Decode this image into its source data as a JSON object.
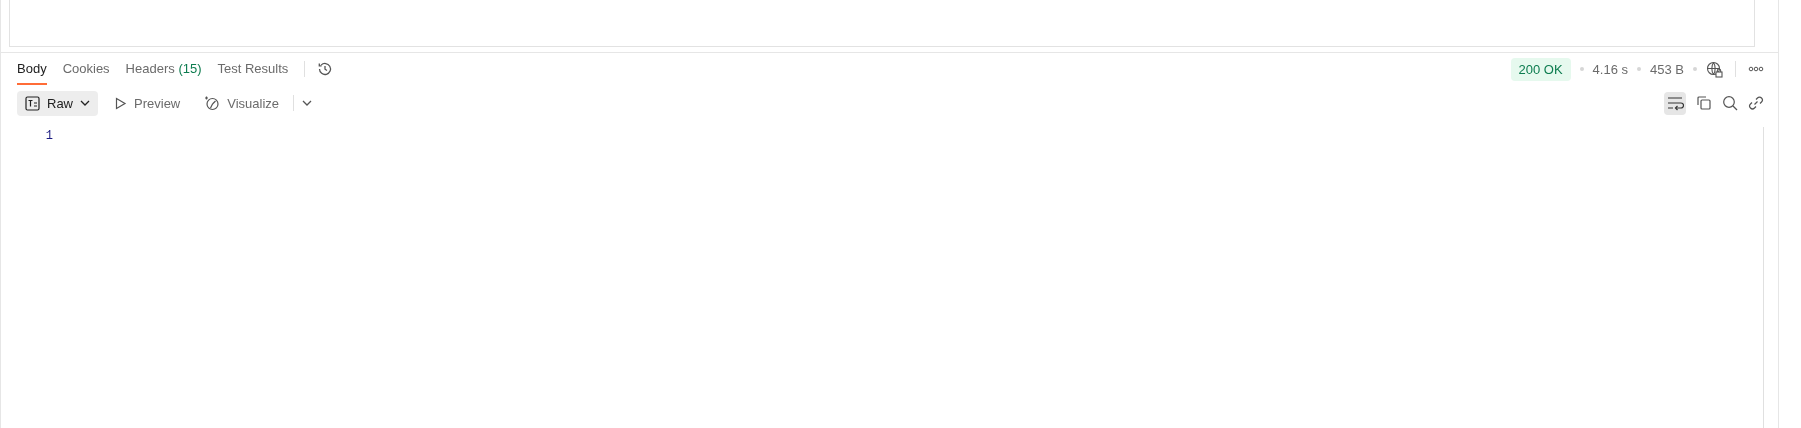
{
  "tabs": [
    {
      "label": "Body",
      "selected": true
    },
    {
      "label": "Cookies",
      "selected": false
    },
    {
      "label": "Headers",
      "count": "(15)",
      "selected": false
    },
    {
      "label": "Test Results",
      "selected": false
    }
  ],
  "status": {
    "code": "200 OK",
    "time": "4.16 s",
    "size": "453 B"
  },
  "view_modes": [
    {
      "label": "Raw",
      "kind": "dropdown",
      "selected": true
    },
    {
      "label": "Preview",
      "kind": "preview",
      "selected": false
    },
    {
      "label": "Visualize",
      "kind": "visualize",
      "selected": false
    }
  ],
  "wrap_lines": {
    "on": true
  },
  "editor": {
    "line_numbers": [
      "1"
    ]
  }
}
